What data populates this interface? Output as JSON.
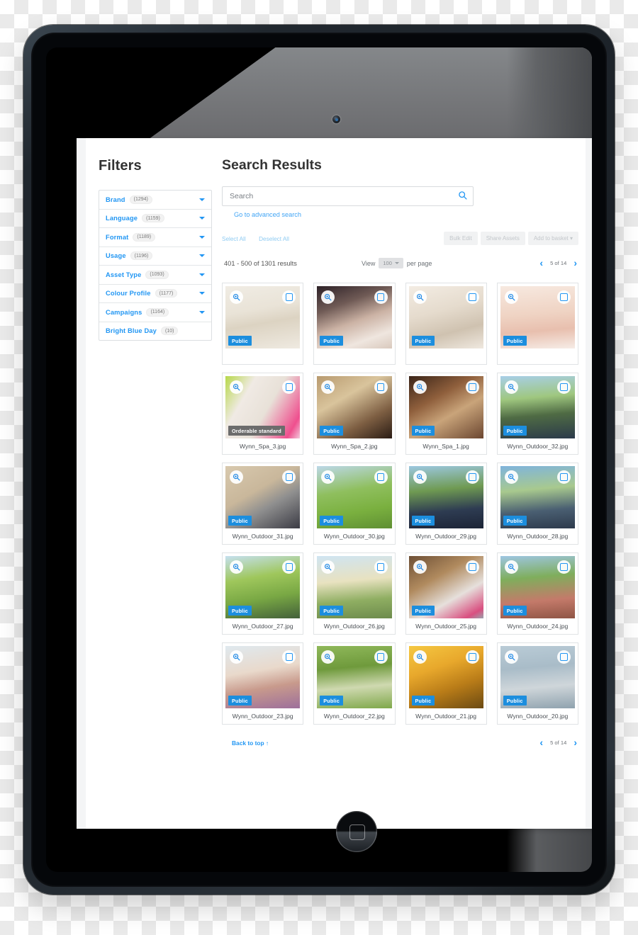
{
  "device": {
    "type": "tablet",
    "camera_icon": "camera-icon",
    "home_button_icon": "home-button-icon"
  },
  "sidebar": {
    "title": "Filters",
    "items": [
      {
        "label": "Brand",
        "count": "(1294)",
        "has_caret": true
      },
      {
        "label": "Language",
        "count": "(1159)",
        "has_caret": true
      },
      {
        "label": "Format",
        "count": "(1189)",
        "has_caret": true
      },
      {
        "label": "Usage",
        "count": "(1196)",
        "has_caret": true
      },
      {
        "label": "Asset Type",
        "count": "(1093)",
        "has_caret": true
      },
      {
        "label": "Colour Profile",
        "count": "(1177)",
        "has_caret": true
      },
      {
        "label": "Campaigns",
        "count": "(1164)",
        "has_caret": true
      },
      {
        "label": "Bright Blue Day",
        "count": "(10)",
        "has_caret": false
      }
    ]
  },
  "main": {
    "title": "Search Results",
    "search": {
      "placeholder": "Search",
      "value": "",
      "icon": "search-icon"
    },
    "advanced_search_link": "Go to advanced search",
    "select_all": "Select All",
    "deselect_all": "Deselect All",
    "actions": [
      {
        "label": "Bulk Edit",
        "disabled": true
      },
      {
        "label": "Share Assets",
        "disabled": true
      },
      {
        "label": "Add to basket ▾",
        "disabled": true
      }
    ],
    "results_count": "401 - 500 of 1301 results",
    "view_prefix": "View",
    "per_page_value": "100",
    "view_suffix": "per page",
    "pager": {
      "prev_icon": "chevron-left-icon",
      "next_icon": "chevron-right-icon",
      "label": "5 of 14"
    },
    "back_to_top": "Back to top ↑"
  },
  "colors": {
    "accent_blue": "#2196f3",
    "badge_public": "#1c8ede",
    "badge_orderable": "#6c6c6c",
    "disabled_button": "#f1f2f3",
    "page_background": "#ffffff"
  },
  "grid": {
    "zoom_icon": "magnifier-plus-icon",
    "checkbox_icon": "checkbox-icon",
    "items": [
      {
        "caption": "",
        "badge": "Public",
        "badge_type": "public",
        "art": "linear-gradient(170deg,#f0ece4 0%,#e9e3d7 38%,#dcd3c2 58%,#efeae1 100%)"
      },
      {
        "caption": "",
        "badge": "Public",
        "badge_type": "public",
        "art": "linear-gradient(160deg,#2d2127 0%,#6f5a55 30%,#cbb2a4 55%,#efe6df 80%,#d9c9bd 100%)"
      },
      {
        "caption": "",
        "badge": "Public",
        "badge_type": "public",
        "art": "linear-gradient(165deg,#f3ece3 0%,#e5dbcd 40%,#cfc2b0 70%,#efe8df 100%)"
      },
      {
        "caption": "",
        "badge": "Public",
        "badge_type": "public",
        "art": "linear-gradient(175deg,#f7e9e0 0%,#efd3c3 45%,#e8bfae 70%,#f6ece6 100%)"
      },
      {
        "caption": "Wynn_Spa_3.jpg",
        "badge": "Orderable standard",
        "badge_type": "orderable",
        "art": "linear-gradient(120deg,#b7d84a 0%,#f0eae4 28%,#e8e1d8 55%,#ef4f8e 88%,#f2c9dc 100%)"
      },
      {
        "caption": "Wynn_Spa_2.jpg",
        "badge": "Public",
        "badge_type": "public",
        "art": "linear-gradient(150deg,#b89a6f 0%,#d9c49c 35%,#7d5e42 70%,#2a1c14 100%)"
      },
      {
        "caption": "Wynn_Spa_1.jpg",
        "badge": "Public",
        "badge_type": "public",
        "art": "linear-gradient(150deg,#3a2418 0%,#8f5f3c 35%,#c9a47a 60%,#6b4630 100%)"
      },
      {
        "caption": "Wynn_Outdoor_32.jpg",
        "badge": "Public",
        "badge_type": "public",
        "art": "linear-gradient(175deg,#a8cfe8 0%,#9fc77f 35%,#4f6b44 62%,#2b3a4a 100%)"
      },
      {
        "caption": "Wynn_Outdoor_31.jpg",
        "badge": "Public",
        "badge_type": "public",
        "art": "linear-gradient(150deg,#d8c9ae 0%,#c9b79b 40%,#8f8f8f 62%,#3b3b44 100%)"
      },
      {
        "caption": "Wynn_Outdoor_30.jpg",
        "badge": "Public",
        "badge_type": "public",
        "art": "linear-gradient(170deg,#bcd8e8 0%,#8fbf5e 40%,#7ab03f 70%,#5f8f33 100%)"
      },
      {
        "caption": "Wynn_Outdoor_29.jpg",
        "badge": "Public",
        "badge_type": "public",
        "art": "linear-gradient(175deg,#9cc8e0 0%,#6f9a52 38%,#2e3c52 70%,#1c2436 100%)"
      },
      {
        "caption": "Wynn_Outdoor_28.jpg",
        "badge": "Public",
        "badge_type": "public",
        "art": "linear-gradient(175deg,#7fb4dc 0%,#a8c98e 38%,#4a5f72 70%,#2d3a4c 100%)"
      },
      {
        "caption": "Wynn_Outdoor_27.jpg",
        "badge": "Public",
        "badge_type": "public",
        "art": "linear-gradient(170deg,#c5e0ef 0%,#9fc75c 35%,#79a844 65%,#43603a 100%)"
      },
      {
        "caption": "Wynn_Outdoor_26.jpg",
        "badge": "Public",
        "badge_type": "public",
        "art": "linear-gradient(175deg,#cfe4f2 0%,#e8e2c0 40%,#8fae62 70%,#6d8b4c 100%)"
      },
      {
        "caption": "Wynn_Outdoor_25.jpg",
        "badge": "Public",
        "badge_type": "public",
        "art": "linear-gradient(150deg,#6d4f35 0%,#b08a5e 35%,#e6e0dc 65%,#d94f80 90%,#9aa3ad 100%)"
      },
      {
        "caption": "Wynn_Outdoor_24.jpg",
        "badge": "Public",
        "badge_type": "public",
        "art": "linear-gradient(175deg,#9ec6e2 0%,#7fae5c 35%,#c47a6a 70%,#8f5545 100%)"
      },
      {
        "caption": "Wynn_Outdoor_23.jpg",
        "badge": "Public",
        "badge_type": "public",
        "art": "linear-gradient(170deg,#dfe9ef 0%,#e9d9cb 40%,#c89a8c 65%,#9d6f9b 100%)"
      },
      {
        "caption": "Wynn_Outdoor_22.jpg",
        "badge": "Public",
        "badge_type": "public",
        "art": "linear-gradient(175deg,#8fb85a 0%,#6f9a3c 35%,#cfd9b0 65%,#7fa84a 100%)"
      },
      {
        "caption": "Wynn_Outdoor_21.jpg",
        "badge": "Public",
        "badge_type": "public",
        "art": "linear-gradient(160deg,#f5c842 0%,#e8a82c 35%,#b97c18 65%,#6b4a12 100%)"
      },
      {
        "caption": "Wynn_Outdoor_20.jpg",
        "badge": "Public",
        "badge_type": "public",
        "art": "linear-gradient(175deg,#b9cbd6 0%,#a9bcc8 35%,#cfd6da 65%,#8fa2ae 100%)"
      }
    ]
  }
}
